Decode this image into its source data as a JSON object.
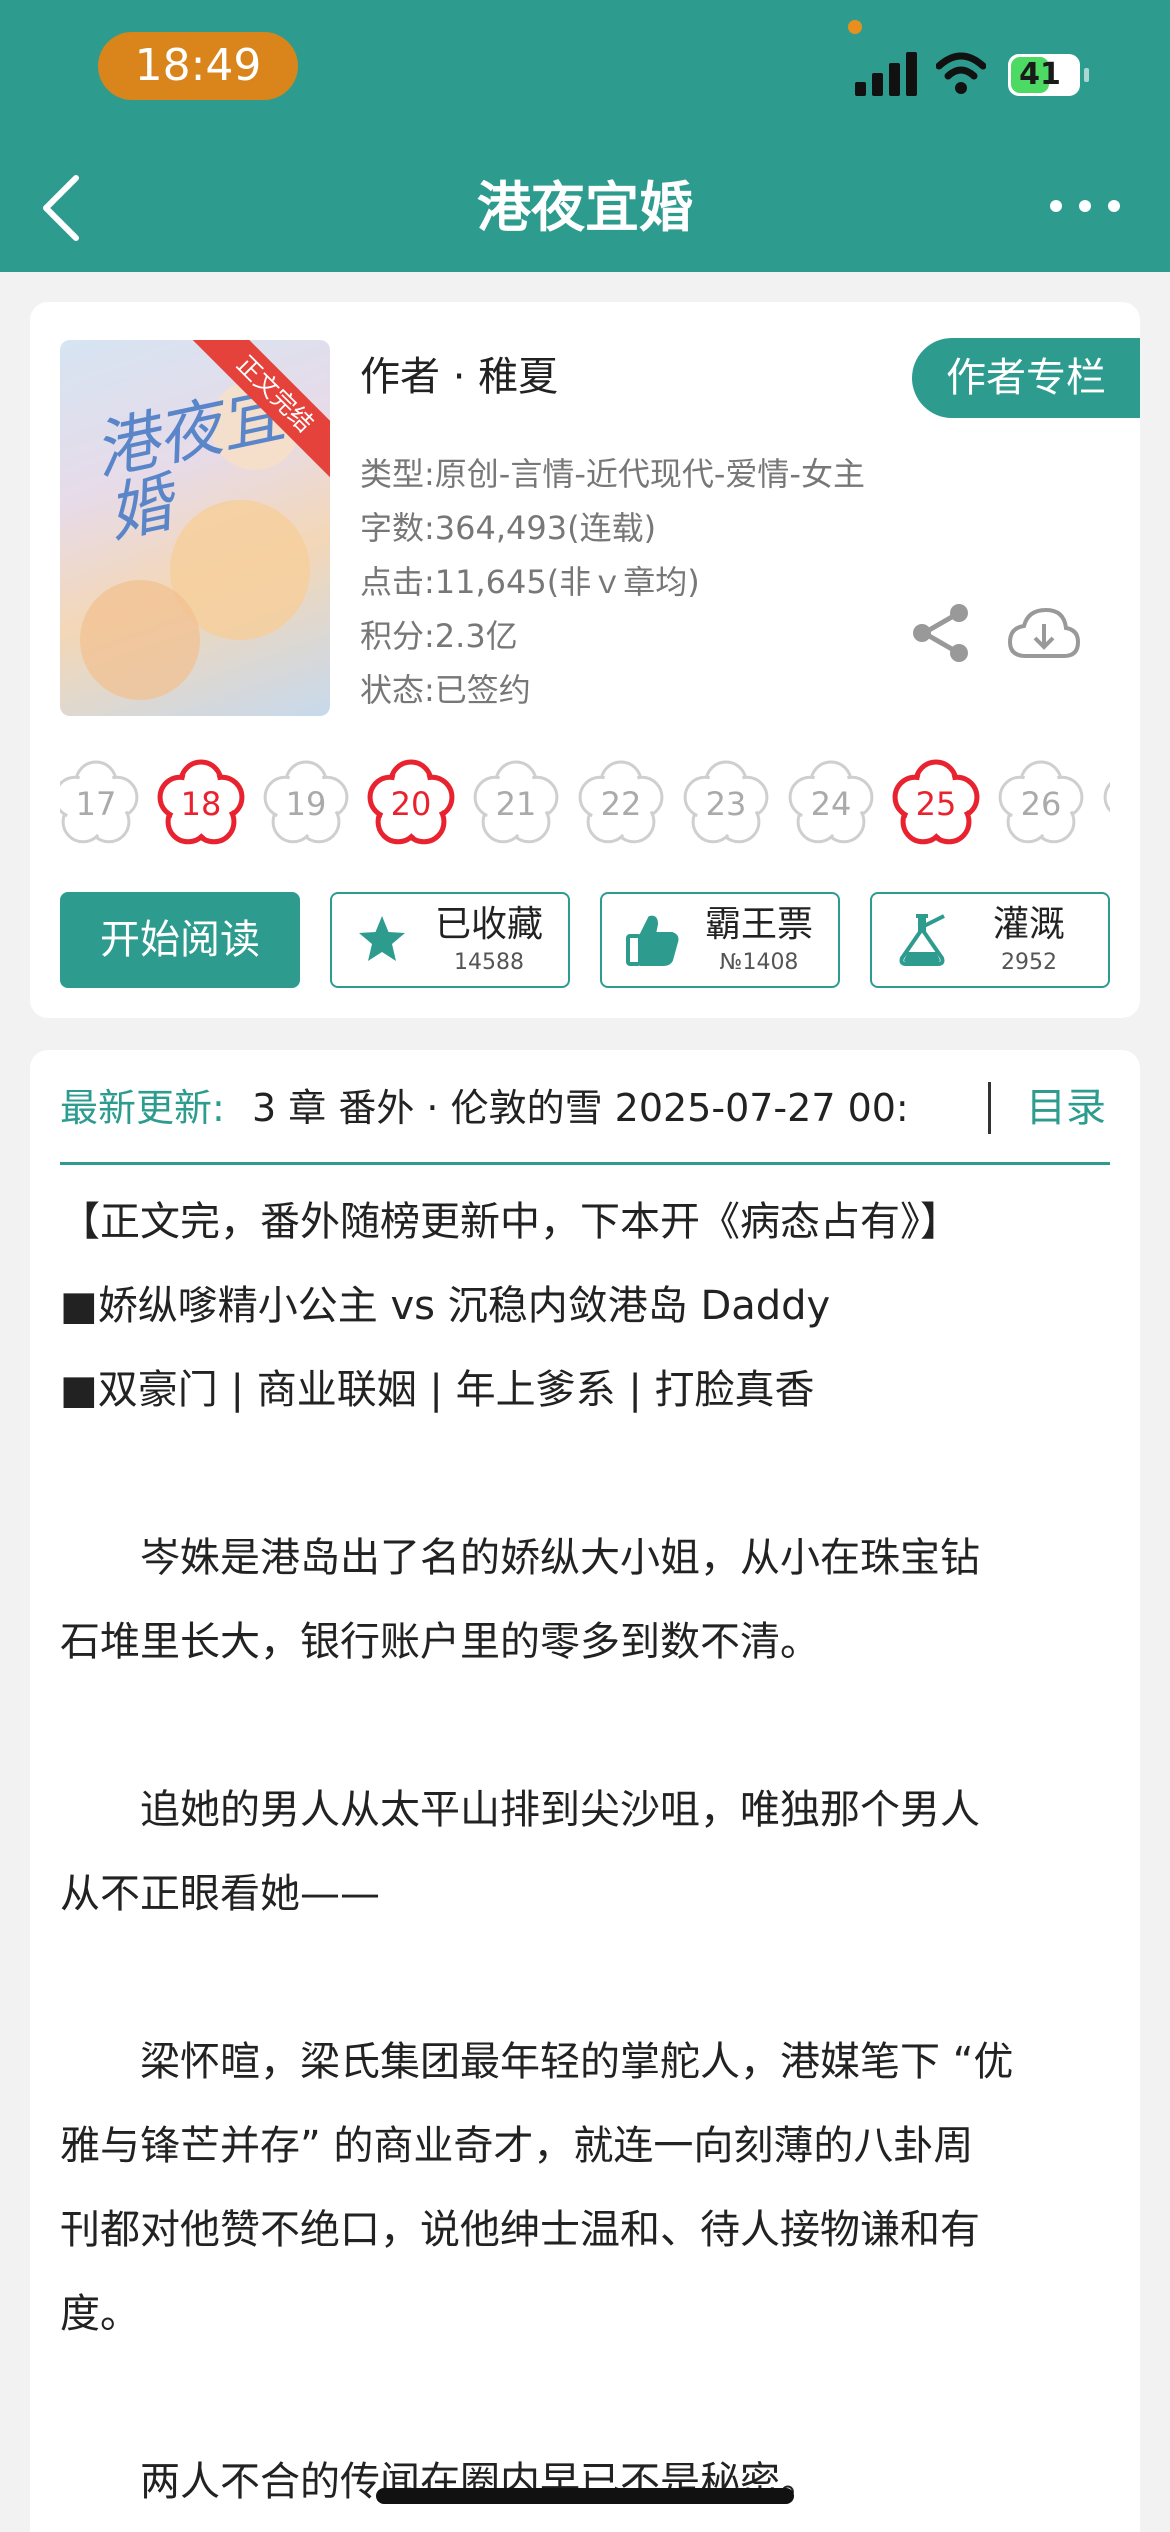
{
  "status_bar": {
    "time": "18:49",
    "battery": "41"
  },
  "nav": {
    "title": "港夜宜婚"
  },
  "book": {
    "cover_title": "港夜宜婚",
    "ribbon": "正文完结",
    "author": "作者 · 稚夏",
    "author_column": "作者专栏",
    "type": "类型:原创-言情-近代现代-爱情-女主",
    "words": "字数:364,493(连载)",
    "clicks": "点击:11,645(非ｖ章均)",
    "points": "积分:2.3亿",
    "status": "状态:已签约"
  },
  "flowers": [
    {
      "label": "17",
      "highlight": false
    },
    {
      "label": "18",
      "highlight": true
    },
    {
      "label": "19",
      "highlight": false
    },
    {
      "label": "20",
      "highlight": true
    },
    {
      "label": "21",
      "highlight": false
    },
    {
      "label": "22",
      "highlight": false
    },
    {
      "label": "23",
      "highlight": false
    },
    {
      "label": "24",
      "highlight": false
    },
    {
      "label": "25",
      "highlight": true
    },
    {
      "label": "26",
      "highlight": false
    }
  ],
  "actions": {
    "read": "开始阅读",
    "collect": {
      "label": "已收藏",
      "count": "14588"
    },
    "ticket": {
      "label": "霸王票",
      "count": "№1408"
    },
    "water": {
      "label": "灌溉",
      "count": "2952"
    }
  },
  "update": {
    "label": "最新更新:",
    "text": "3 章 番外 · 伦敦的雪 2025-07-27 00:",
    "toc": "目录"
  },
  "description": [
    "【正文完，番外随榜更新中，下本开《病态占有》】",
    "■娇纵嗲精小公主 vs 沉稳内敛港岛 Daddy",
    "■双豪门 | 商业联姻 | 年上爹系 | 打脸真香",
    "",
    "　　岑姝是港岛出了名的娇纵大小姐，从小在珠宝钻",
    "石堆里长大，银行账户里的零多到数不清。",
    "",
    "　　追她的男人从太平山排到尖沙咀，唯独那个男人",
    "从不正眼看她——",
    "",
    "　　梁怀暄，梁氏集团最年轻的掌舵人，港媒笔下 “优",
    "雅与锋芒并存” 的商业奇才，就连一向刻薄的八卦周",
    "刊都对他赞不绝口，说他绅士温和、待人接物谦和有",
    "度。",
    "",
    "　　两人不合的传闻在圈内早已不是秘密。"
  ],
  "colors": {
    "accent": "#2d9c8f",
    "highlight_red": "#e8232f",
    "time_pill": "#d9851c"
  }
}
